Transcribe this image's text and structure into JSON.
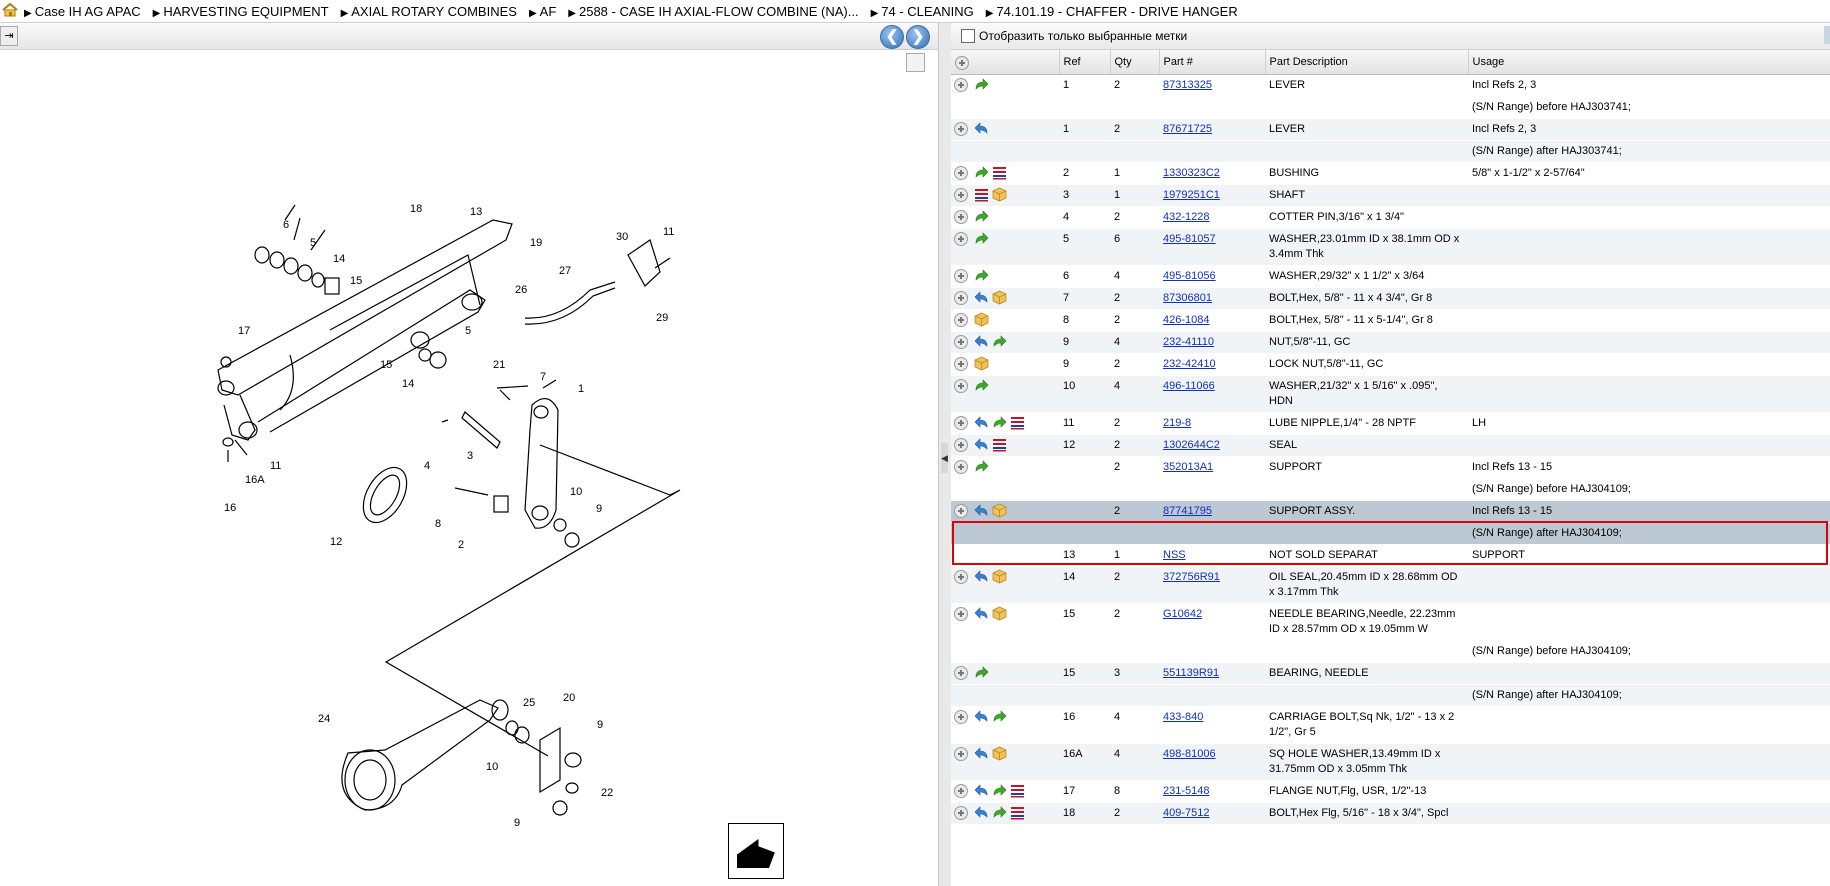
{
  "breadcrumb": [
    "Case IH AG APAC",
    "HARVESTING EQUIPMENT",
    "AXIAL ROTARY COMBINES",
    "AF",
    "2588 - CASE IH AXIAL-FLOW COMBINE (NA)...",
    "74 - CLEANING",
    "74.101.19 - CHAFFER - DRIVE HANGER"
  ],
  "filter_label": "Отобразить только выбранные метки",
  "columns": {
    "ref": "Ref",
    "qty": "Qty",
    "part": "Part #",
    "desc": "Part Description",
    "usage": "Usage"
  },
  "diagram_labels": [
    "18",
    "13",
    "6",
    "5",
    "14",
    "15",
    "19",
    "30",
    "11",
    "27",
    "26",
    "29",
    "17",
    "21",
    "7",
    "1",
    "15",
    "5",
    "14",
    "4",
    "3",
    "10",
    "9",
    "2",
    "8",
    "12",
    "16A",
    "16",
    "11",
    "24",
    "25",
    "20",
    "9",
    "10",
    "22",
    "9"
  ],
  "rows": [
    {
      "icons": [
        "plus",
        "fwd"
      ],
      "ref": "1",
      "qty": "2",
      "part": "87313325",
      "desc": "LEVER",
      "usage": "Incl Refs 2, 3",
      "alt": false
    },
    {
      "icons": [],
      "ref": "",
      "qty": "",
      "part": "",
      "desc": "",
      "usage": "(S/N Range) before HAJ303741;",
      "alt": false
    },
    {
      "icons": [
        "plus",
        "back"
      ],
      "ref": "1",
      "qty": "2",
      "part": "87671725",
      "desc": "LEVER",
      "usage": "Incl Refs 2, 3",
      "alt": true
    },
    {
      "icons": [],
      "ref": "",
      "qty": "",
      "part": "",
      "desc": "",
      "usage": "(S/N Range) after HAJ303741;",
      "alt": true
    },
    {
      "icons": [
        "plus",
        "fwd",
        "list"
      ],
      "ref": "2",
      "qty": "1",
      "part": "1330323C2",
      "desc": "BUSHING",
      "usage": "5/8\" x 1-1/2\" x 2-57/64\"",
      "alt": false
    },
    {
      "icons": [
        "plus",
        "list",
        "box"
      ],
      "ref": "3",
      "qty": "1",
      "part": "1979251C1",
      "desc": "SHAFT",
      "usage": "",
      "alt": true
    },
    {
      "icons": [
        "plus",
        "fwd"
      ],
      "ref": "4",
      "qty": "2",
      "part": "432-1228",
      "desc": "COTTER PIN,3/16\" x 1 3/4\"",
      "usage": "",
      "alt": false
    },
    {
      "icons": [
        "plus",
        "fwd"
      ],
      "ref": "5",
      "qty": "6",
      "part": "495-81057",
      "desc": "WASHER,23.01mm ID x 38.1mm OD x 3.4mm Thk",
      "usage": "",
      "alt": true
    },
    {
      "icons": [
        "plus",
        "fwd"
      ],
      "ref": "6",
      "qty": "4",
      "part": "495-81056",
      "desc": "WASHER,29/32\" x 1 1/2\" x 3/64",
      "usage": "",
      "alt": false
    },
    {
      "icons": [
        "plus",
        "back",
        "box"
      ],
      "ref": "7",
      "qty": "2",
      "part": "87306801",
      "desc": "BOLT,Hex, 5/8\" - 11 x 4 3/4\", Gr 8",
      "usage": "",
      "alt": true
    },
    {
      "icons": [
        "plus",
        "box"
      ],
      "ref": "8",
      "qty": "2",
      "part": "426-1084",
      "desc": "BOLT,Hex, 5/8\" - 11 x 5-1/4\", Gr 8",
      "usage": "",
      "alt": false
    },
    {
      "icons": [
        "plus",
        "back",
        "fwd"
      ],
      "ref": "9",
      "qty": "4",
      "part": "232-41110",
      "desc": "NUT,5/8\"-11, GC",
      "usage": "",
      "alt": true
    },
    {
      "icons": [
        "plus",
        "box"
      ],
      "ref": "9",
      "qty": "2",
      "part": "232-42410",
      "desc": "LOCK NUT,5/8\"-11, GC",
      "usage": "",
      "alt": false
    },
    {
      "icons": [
        "plus",
        "fwd"
      ],
      "ref": "10",
      "qty": "4",
      "part": "496-11066",
      "desc": "WASHER,21/32\" x 1 5/16\" x .095\", HDN",
      "usage": "",
      "alt": true
    },
    {
      "icons": [
        "plus",
        "back",
        "fwd",
        "list"
      ],
      "ref": "11",
      "qty": "2",
      "part": "219-8",
      "desc": "LUBE NIPPLE,1/4\" - 28 NPTF",
      "usage": "LH",
      "alt": false
    },
    {
      "icons": [
        "plus",
        "back",
        "list"
      ],
      "ref": "12",
      "qty": "2",
      "part": "1302644C2",
      "desc": "SEAL",
      "usage": "",
      "alt": true
    },
    {
      "icons": [
        "plus",
        "fwd"
      ],
      "ref": "",
      "qty": "2",
      "part": "352013A1",
      "desc": "SUPPORT",
      "usage": "Incl Refs 13 - 15",
      "alt": false
    },
    {
      "icons": [],
      "ref": "",
      "qty": "",
      "part": "",
      "desc": "",
      "usage": "(S/N Range) before HAJ304109;",
      "alt": false
    },
    {
      "icons": [
        "plus",
        "back",
        "box"
      ],
      "ref": "",
      "qty": "2",
      "part": "87741795",
      "desc": "SUPPORT ASSY.",
      "usage": "Incl Refs 13 - 15",
      "sel": true
    },
    {
      "icons": [],
      "ref": "",
      "qty": "",
      "part": "",
      "desc": "",
      "usage": "(S/N Range) after HAJ304109;",
      "sel": true
    },
    {
      "icons": [],
      "ref": "13",
      "qty": "1",
      "part": "NSS",
      "desc": "NOT SOLD SEPARAT",
      "usage": "SUPPORT",
      "alt": false
    },
    {
      "icons": [
        "plus",
        "back",
        "box"
      ],
      "ref": "14",
      "qty": "2",
      "part": "372756R91",
      "desc": "OIL SEAL,20.45mm ID x 28.68mm OD x 3.17mm Thk",
      "usage": "",
      "alt": true
    },
    {
      "icons": [
        "plus",
        "back",
        "box"
      ],
      "ref": "15",
      "qty": "2",
      "part": "G10642",
      "desc": "NEEDLE BEARING,Needle, 22.23mm ID x 28.57mm OD x 19.05mm W",
      "usage": "",
      "alt": false
    },
    {
      "icons": [],
      "ref": "",
      "qty": "",
      "part": "",
      "desc": "",
      "usage": "(S/N Range) before HAJ304109;",
      "alt": false
    },
    {
      "icons": [
        "plus",
        "fwd"
      ],
      "ref": "15",
      "qty": "3",
      "part": "551139R91",
      "desc": "BEARING, NEEDLE",
      "usage": "",
      "alt": true
    },
    {
      "icons": [],
      "ref": "",
      "qty": "",
      "part": "",
      "desc": "",
      "usage": "(S/N Range) after HAJ304109;",
      "alt": true
    },
    {
      "icons": [
        "plus",
        "back",
        "fwd"
      ],
      "ref": "16",
      "qty": "4",
      "part": "433-840",
      "desc": "CARRIAGE BOLT,Sq Nk, 1/2\" - 13 x 2 1/2\", Gr 5",
      "usage": "",
      "alt": false
    },
    {
      "icons": [
        "plus",
        "back",
        "box"
      ],
      "ref": "16A",
      "qty": "4",
      "part": "498-81006",
      "desc": "SQ HOLE WASHER,13.49mm ID x 31.75mm OD x 3.05mm Thk",
      "usage": "",
      "alt": true
    },
    {
      "icons": [
        "plus",
        "back",
        "fwd",
        "list"
      ],
      "ref": "17",
      "qty": "8",
      "part": "231-5148",
      "desc": "FLANGE NUT,Flg, USR, 1/2\"-13",
      "usage": "",
      "alt": false
    },
    {
      "icons": [
        "plus",
        "back",
        "fwd",
        "list"
      ],
      "ref": "18",
      "qty": "2",
      "part": "409-7512",
      "desc": "BOLT,Hex Flg, 5/16\" - 18 x 3/4\", Spcl",
      "usage": "",
      "alt": true
    }
  ]
}
